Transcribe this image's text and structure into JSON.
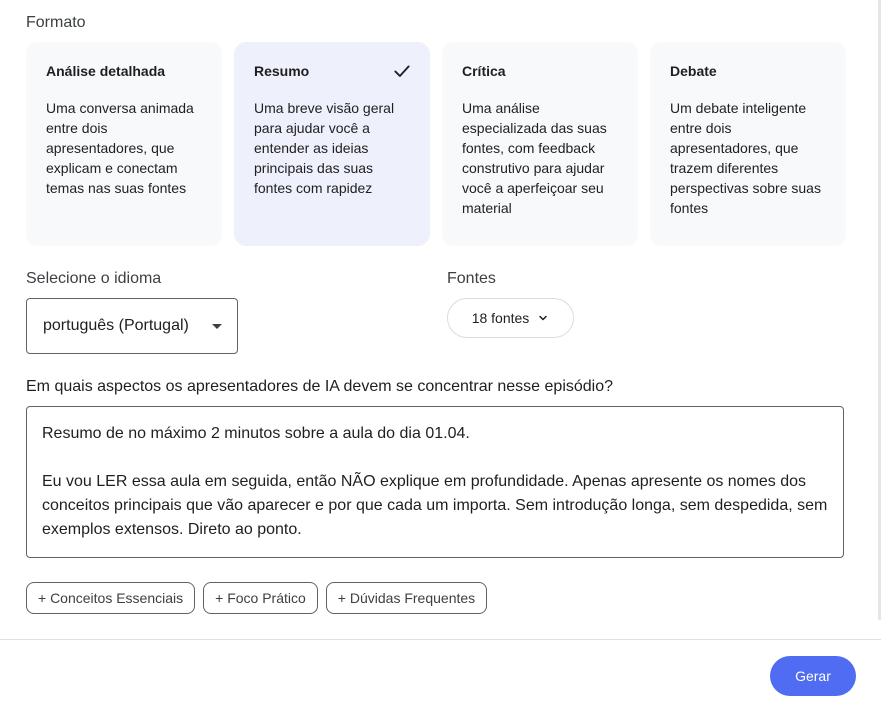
{
  "format": {
    "label": "Formato",
    "cards": [
      {
        "title": "Análise detalhada",
        "desc": "Uma conversa animada entre dois apresentadores, que explicam e conectam temas nas suas fontes",
        "selected": false
      },
      {
        "title": "Resumo",
        "desc": "Uma breve visão geral para ajudar você a entender as ideias principais das suas fontes com rapidez",
        "selected": true
      },
      {
        "title": "Crítica",
        "desc": "Uma análise especializada das suas fontes, com feedback construtivo para ajudar você a aperfeiçoar seu material",
        "selected": false
      },
      {
        "title": "Debate",
        "desc": "Um debate inteligente entre dois apresentadores, que trazem diferentes perspectivas sobre suas fontes",
        "selected": false
      }
    ]
  },
  "language": {
    "label": "Selecione o idioma",
    "value": "português (Portugal)"
  },
  "sources": {
    "label": "Fontes",
    "value": "18 fontes"
  },
  "focus": {
    "label": "Em quais aspectos os apresentadores de IA devem se concentrar nesse episódio?",
    "value": "Resumo de no máximo 2 minutos sobre a aula do dia 01.04.\n\nEu vou LER essa aula em seguida, então NÃO explique em profundidade. Apenas apresente os nomes dos conceitos principais que vão aparecer e por que cada um importa. Sem introdução longa, sem despedida, sem exemplos extensos. Direto ao ponto."
  },
  "suggestions": [
    "+ Conceitos Essenciais",
    "+ Foco Prático",
    "+ Dúvidas Frequentes"
  ],
  "generate_label": "Gerar",
  "colors": {
    "accent": "#4f6cf2",
    "selected_card": "#eef0fc",
    "card": "#f8f9fa"
  }
}
